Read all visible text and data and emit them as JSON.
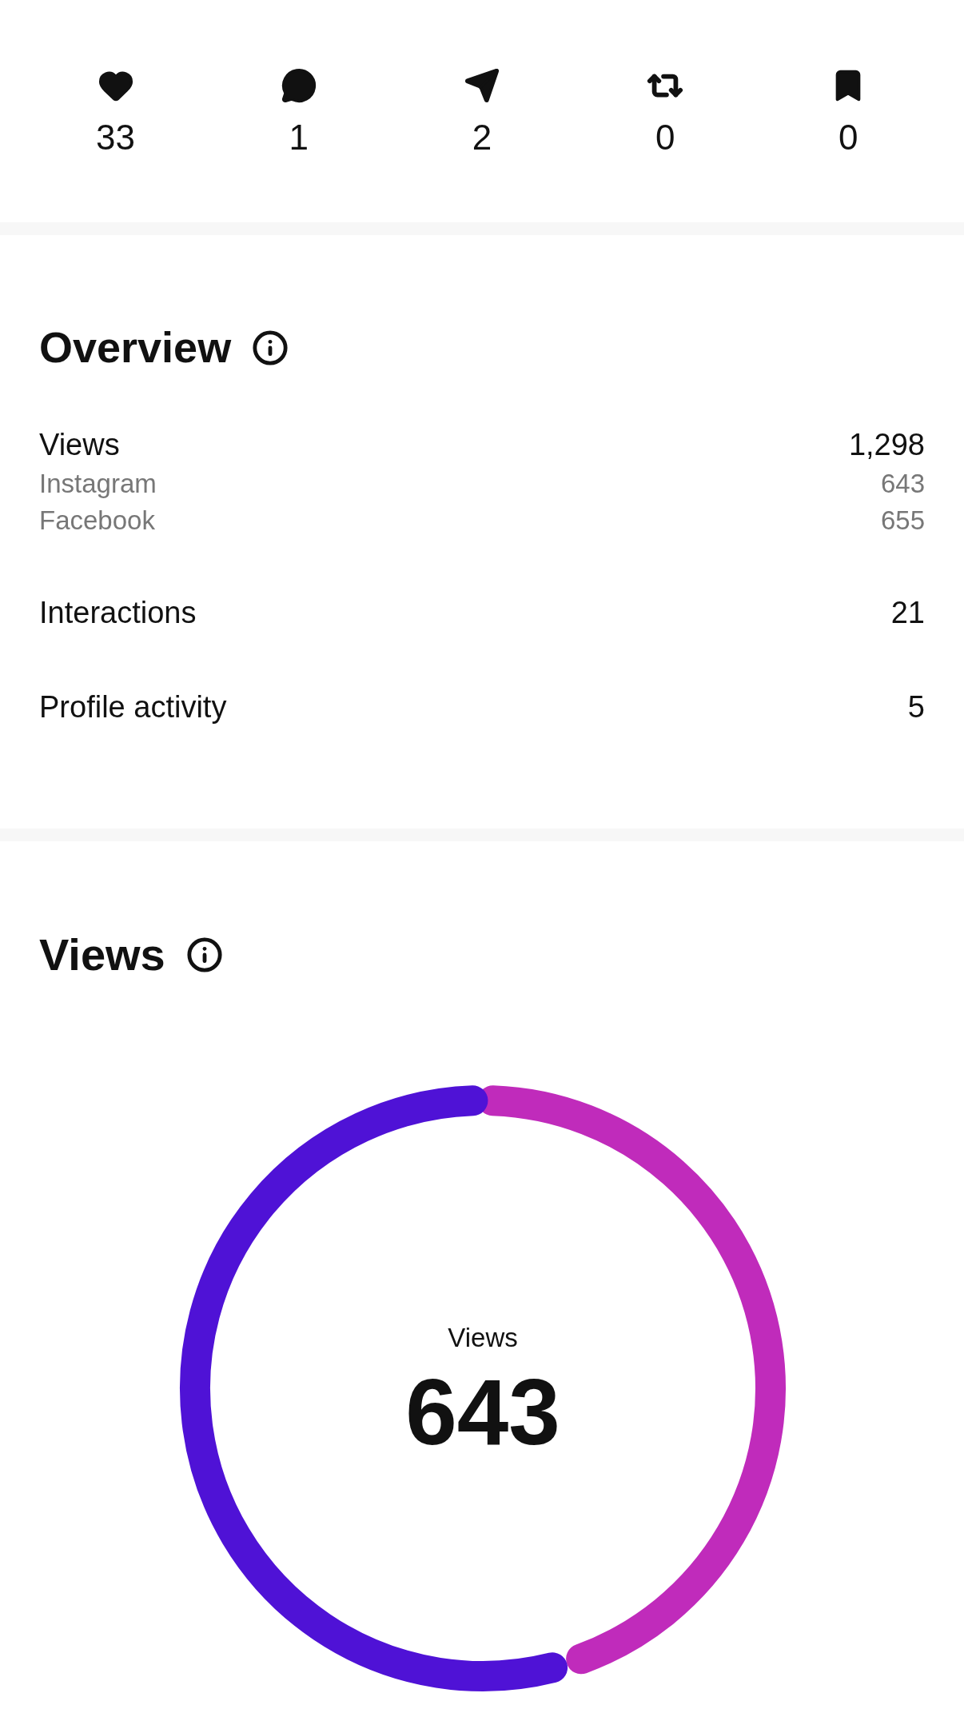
{
  "stats": [
    {
      "kind": "likes",
      "count": "33"
    },
    {
      "kind": "comments",
      "count": "1"
    },
    {
      "kind": "shares",
      "count": "2"
    },
    {
      "kind": "reposts",
      "count": "0"
    },
    {
      "kind": "saves",
      "count": "0"
    }
  ],
  "overview": {
    "title": "Overview",
    "rows": [
      {
        "label": "Views",
        "value": "1,298",
        "sub": [
          {
            "label": "Instagram",
            "value": "643"
          },
          {
            "label": "Facebook",
            "value": "655"
          }
        ]
      },
      {
        "label": "Interactions",
        "value": "21"
      },
      {
        "label": "Profile activity",
        "value": "5"
      }
    ]
  },
  "views": {
    "title": "Views",
    "center_label": "Views",
    "center_value": "643"
  }
}
